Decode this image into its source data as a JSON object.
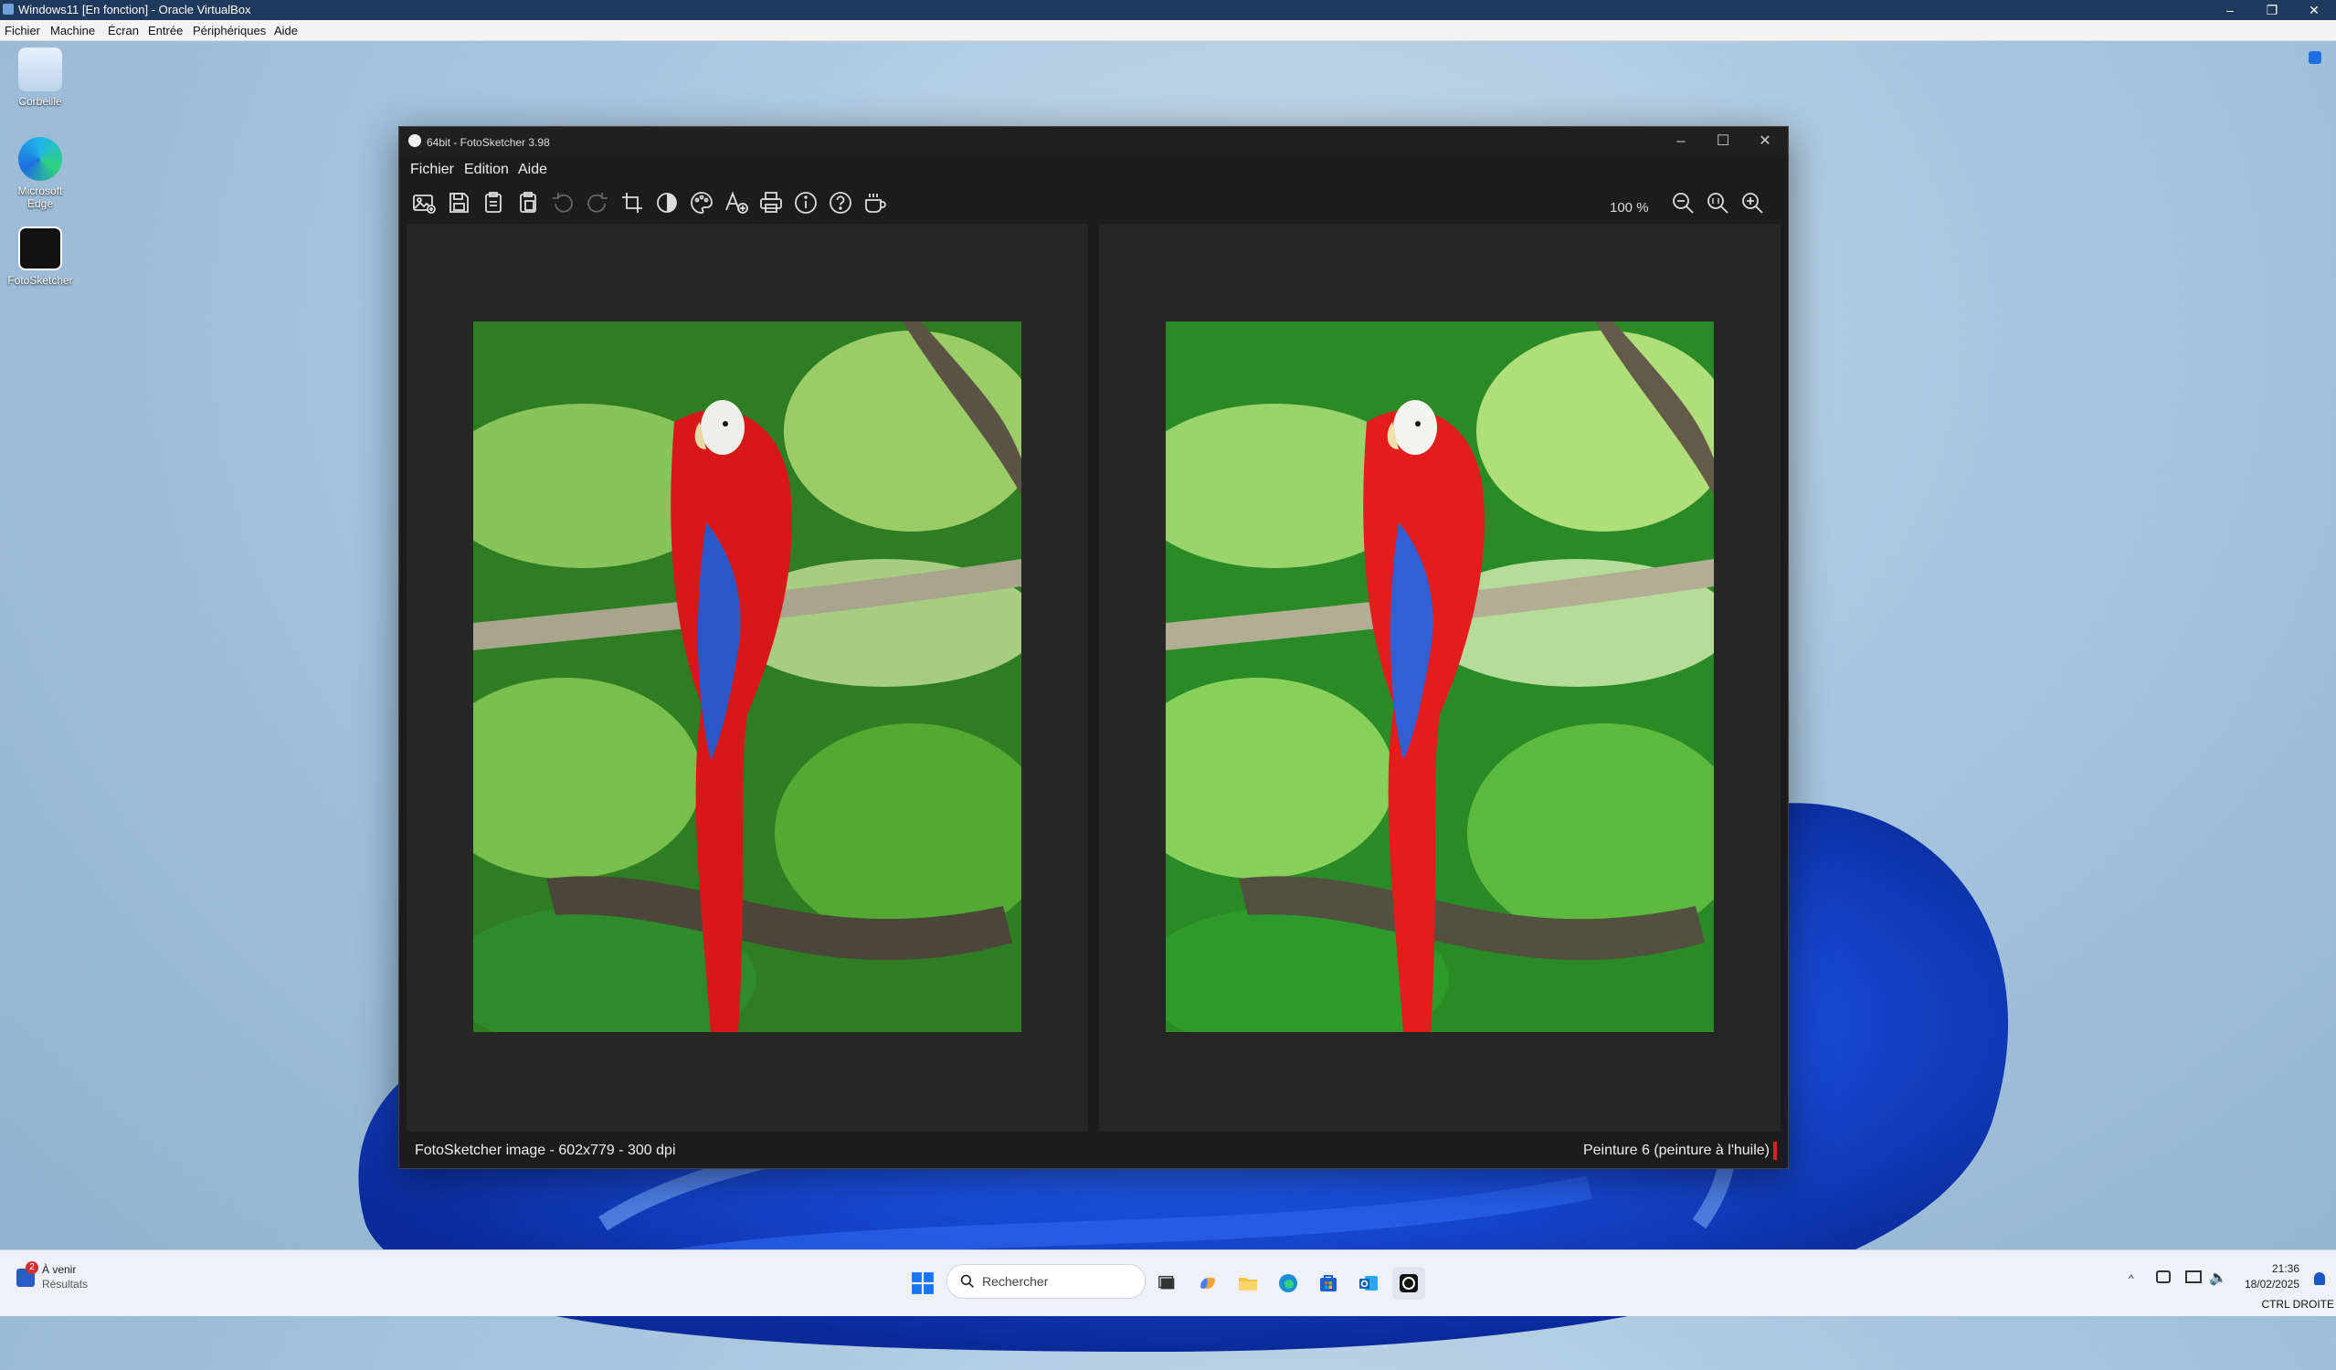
{
  "host": {
    "title": "Windows11 [En fonction] - Oracle VirtualBox",
    "menu": [
      "Fichier",
      "Machine",
      "Écran",
      "Entrée",
      "Périphériques",
      "Aide"
    ],
    "controls": {
      "minimize": "–",
      "restore": "❐",
      "close": "✕"
    },
    "hostkey": "CTRL DROITE"
  },
  "desktop": {
    "icons": [
      {
        "label": "Corbeille"
      },
      {
        "label": "Microsoft Edge"
      },
      {
        "label": "FotoSketcher"
      }
    ]
  },
  "app": {
    "title": "64bit - FotoSketcher 3.98",
    "menu": [
      "Fichier",
      "Edition",
      "Aide"
    ],
    "zoom": "100 %",
    "controls": {
      "minimize": "–",
      "maximize": "☐",
      "close": "✕"
    },
    "status_left": "FotoSketcher image - 602x779 - 300 dpi",
    "status_right": "Peinture 6 (peinture à l'huile)"
  },
  "taskbar": {
    "weather_badge": "2",
    "weather_title": "À venir",
    "weather_sub": "Résultats",
    "search_placeholder": "Rechercher",
    "time": "21:36",
    "date": "18/02/2025"
  },
  "colors": {
    "app_bg": "#1c1c1c",
    "pane_bg": "#262626",
    "parrot_red": "#d81818",
    "foliage_green": "#3c9b2a"
  }
}
